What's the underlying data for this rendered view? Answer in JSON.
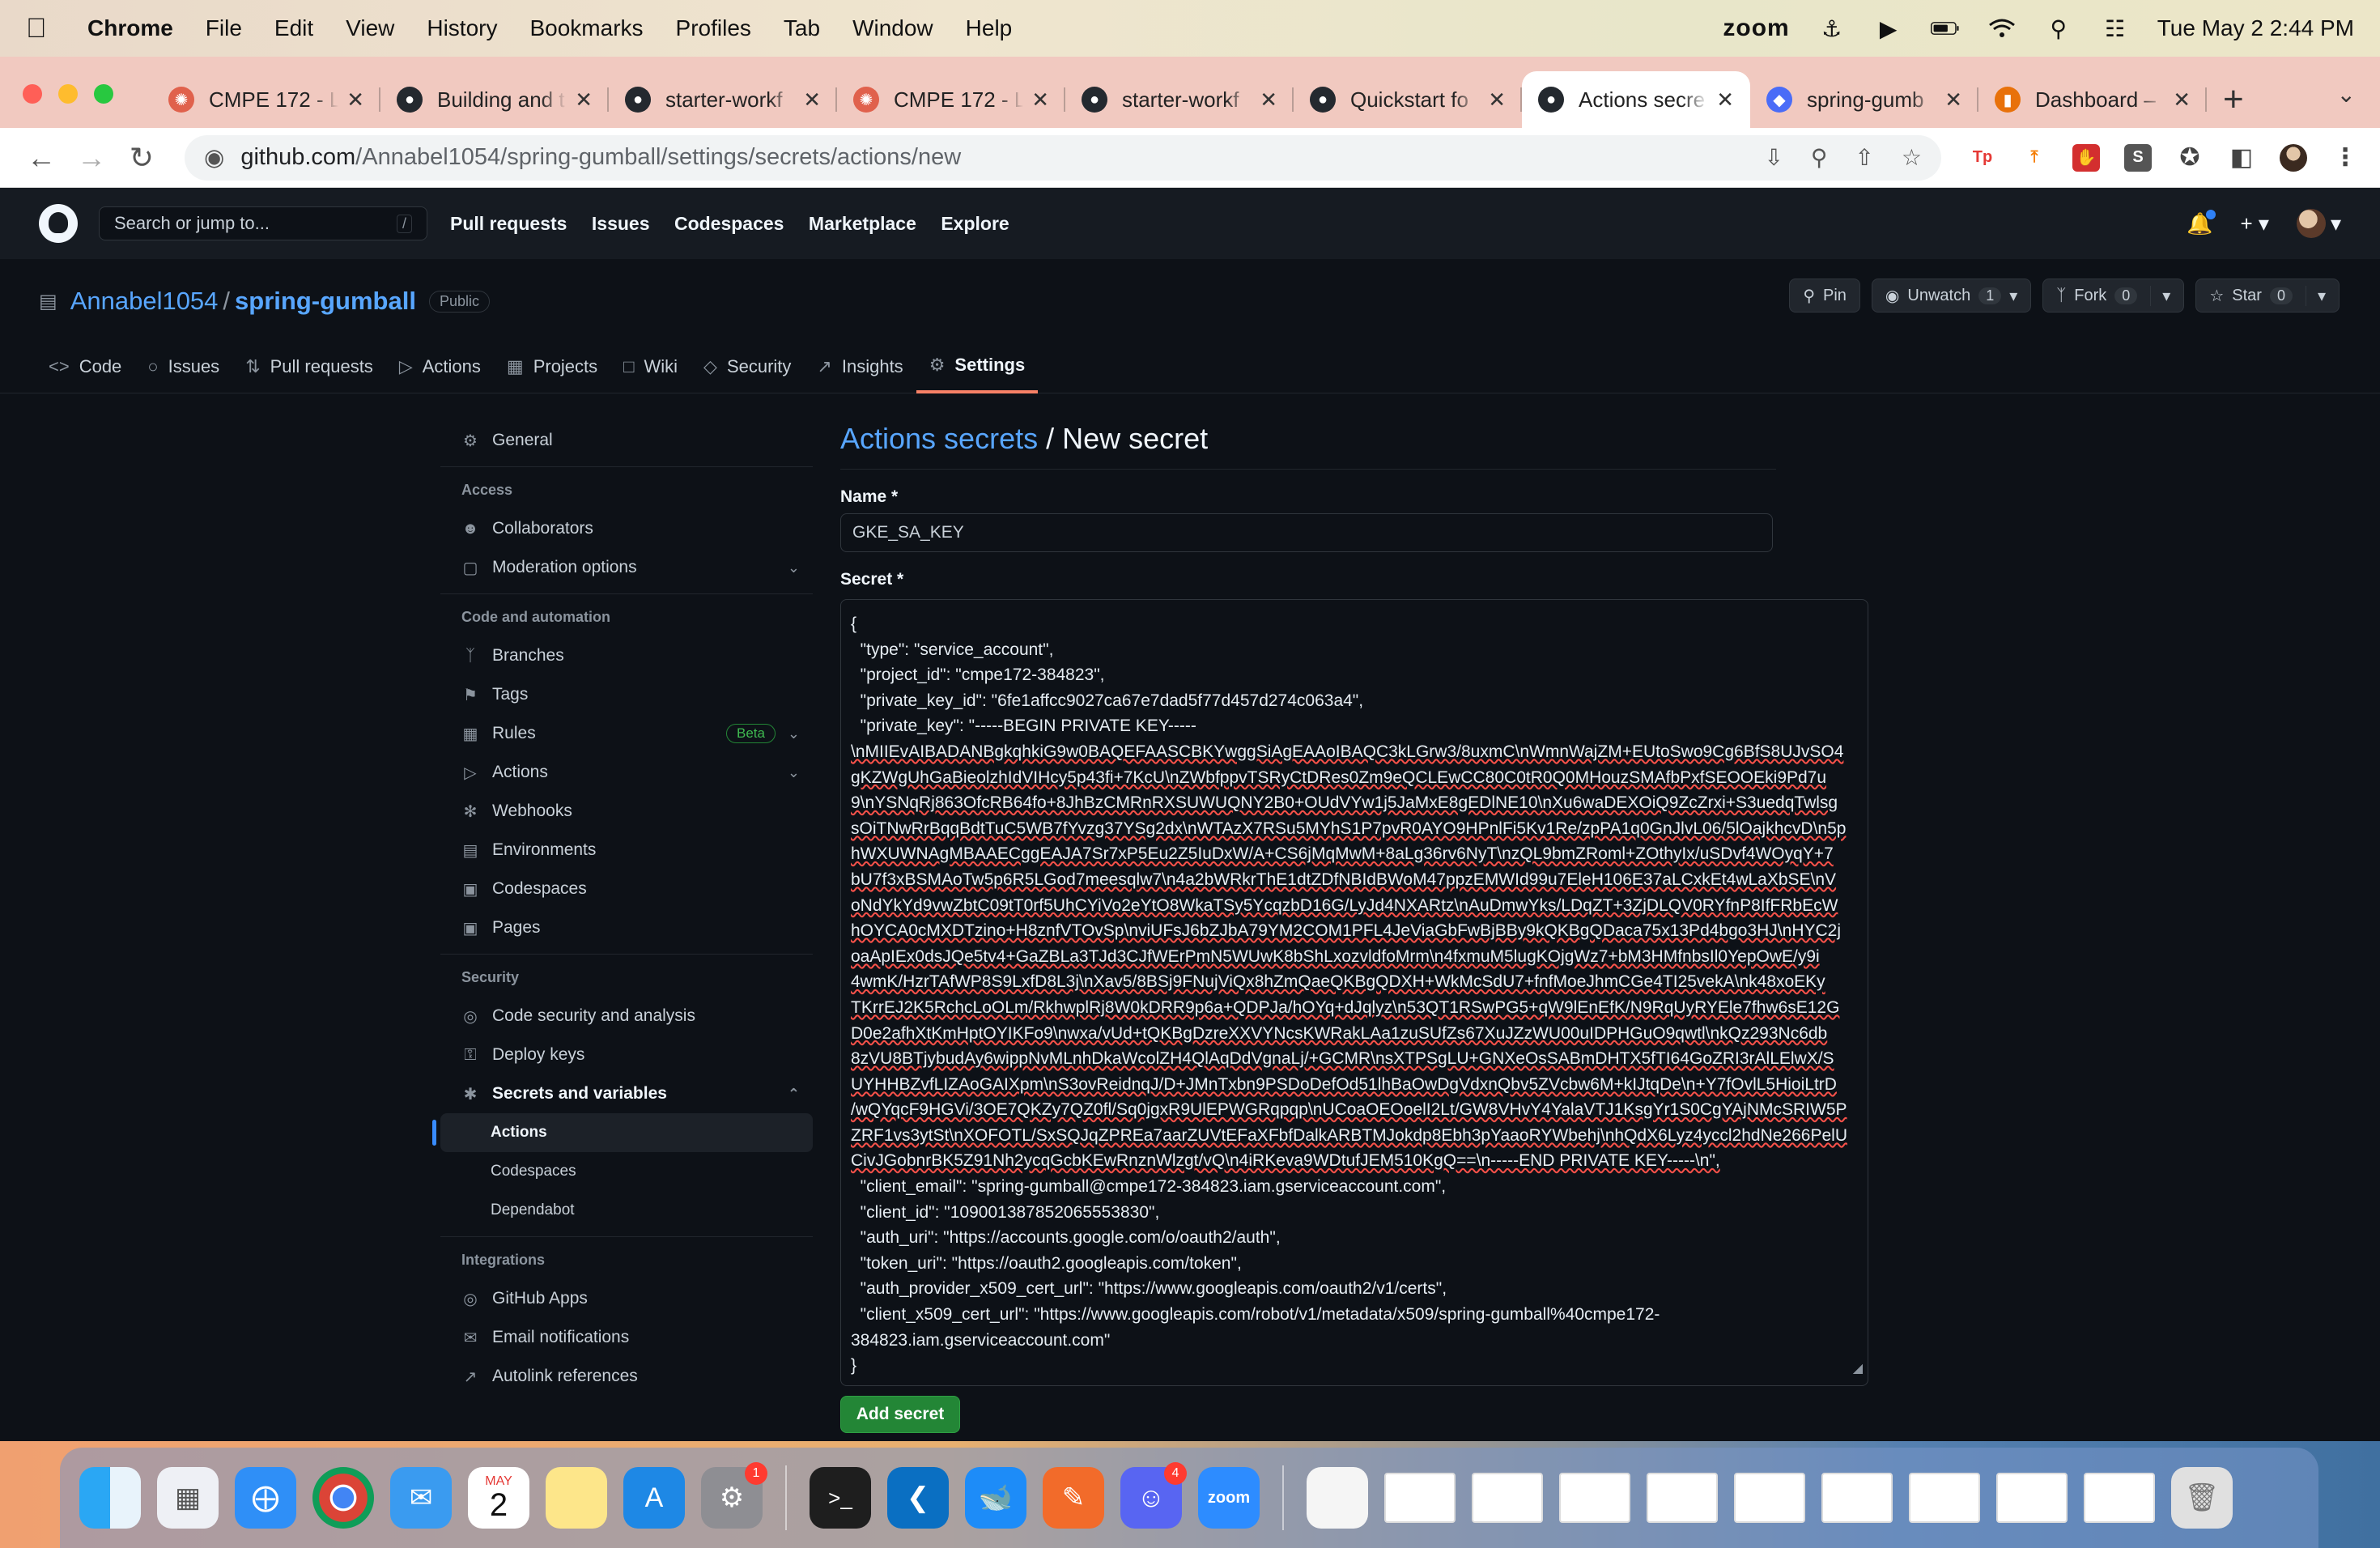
{
  "menubar": {
    "app": "Chrome",
    "items": [
      "File",
      "Edit",
      "View",
      "History",
      "Bookmarks",
      "Profiles",
      "Tab",
      "Window",
      "Help"
    ],
    "zoom": "zoom",
    "datetime": "Tue May 2  2:44 PM"
  },
  "tabs": [
    {
      "title": "CMPE 172 - L",
      "icon": "cmpe-icon",
      "color": "#e0614c"
    },
    {
      "title": "Building and t",
      "icon": "github-icon",
      "color": "#24292f"
    },
    {
      "title": "starter-workf",
      "icon": "github-icon",
      "color": "#24292f"
    },
    {
      "title": "CMPE 172 - L",
      "icon": "cmpe-icon",
      "color": "#e0614c"
    },
    {
      "title": "starter-workf",
      "icon": "github-icon",
      "color": "#24292f"
    },
    {
      "title": "Quickstart fo",
      "icon": "github-icon",
      "color": "#24292f"
    },
    {
      "title": "Actions secre",
      "icon": "github-icon",
      "color": "#24292f",
      "active": true
    },
    {
      "title": "spring-gumb",
      "icon": "shield-icon",
      "color": "#4a6cf7"
    },
    {
      "title": "Dashboard –",
      "icon": "chart-icon",
      "color": "#e8710a"
    }
  ],
  "address": {
    "host": "github.com",
    "path": "/Annabel1054/spring-gumball/settings/secrets/actions/new"
  },
  "gh": {
    "search_placeholder": "Search or jump to...",
    "search_key": "/",
    "nav": [
      "Pull requests",
      "Issues",
      "Codespaces",
      "Marketplace",
      "Explore"
    ]
  },
  "repo": {
    "owner": "Annabel1054",
    "separator": "/",
    "name": "spring-gumball",
    "visibility": "Public",
    "pin": "Pin",
    "unwatch": "Unwatch",
    "watch_count": "1",
    "fork": "Fork",
    "fork_count": "0",
    "star": "Star",
    "star_count": "0",
    "tabs": [
      {
        "label": "Code",
        "icon": "<>"
      },
      {
        "label": "Issues",
        "icon": "○"
      },
      {
        "label": "Pull requests",
        "icon": "⇅"
      },
      {
        "label": "Actions",
        "icon": "▷"
      },
      {
        "label": "Projects",
        "icon": "▦"
      },
      {
        "label": "Wiki",
        "icon": "□"
      },
      {
        "label": "Security",
        "icon": "◇"
      },
      {
        "label": "Insights",
        "icon": "↗"
      },
      {
        "label": "Settings",
        "icon": "⚙"
      }
    ]
  },
  "sidebar": {
    "general": "General",
    "access_heading": "Access",
    "collaborators": "Collaborators",
    "moderation": "Moderation options",
    "code_heading": "Code and automation",
    "branches": "Branches",
    "tags": "Tags",
    "rules": "Rules",
    "beta": "Beta",
    "actions": "Actions",
    "webhooks": "Webhooks",
    "environments": "Environments",
    "codespaces": "Codespaces",
    "pages": "Pages",
    "security_heading": "Security",
    "code_security": "Code security and analysis",
    "deploy_keys": "Deploy keys",
    "secrets": "Secrets and variables",
    "sub_actions": "Actions",
    "sub_codespaces": "Codespaces",
    "sub_dependabot": "Dependabot",
    "integrations_heading": "Integrations",
    "github_apps": "GitHub Apps",
    "email_notifications": "Email notifications",
    "autolink": "Autolink references"
  },
  "main": {
    "crumb": "Actions secrets",
    "sep": "/",
    "title": "New secret",
    "name_label": "Name *",
    "name_value": "GKE_SA_KEY",
    "secret_label": "Secret *",
    "secret_lines": [
      "{",
      "  \"type\": \"service_account\",",
      "  \"project_id\": \"cmpe172-384823\",",
      "  \"private_key_id\": \"6fe1affcc9027ca67e7dad5f77d457d274c063a4\",",
      "  \"private_key\": \"-----BEGIN PRIVATE KEY-----",
      "\\nMIIEvAIBADANBgkqhkiG9w0BAQEFAASCBKYwggSiAgEAAoIBAQC3kLGrw3/8uxmC\\nWmnWajZM+EUtoSwo9Cg6BfS8UJvSO4",
      "gKZWgUhGaBieolzhIdVIHcy5p43fi+7KcU\\nZWbfppvTSRyCtDRes0Zm9eQCLEwCC80C0tR0Q0MHouzSMAfbPxfSEOOEki9Pd7u",
      "9\\nYSNqRj863OfcRB64fo+8JhBzCMRnRXSUWUQNY2B0+OUdVYw1j5JaMxE8gEDlNE10\\nXu6waDEXOiQ9ZcZrxi+S3uedqTwlsg",
      "sOiTNwRrBqqBdtTuC5WB7fYvzg37YSg2dx\\nWTAzX7RSu5MYhS1P7pvR0AYO9HPnlFi5Kv1Re/zpPA1q0GnJlvL06/5lOajkhcvD\\n5p",
      "hWXUWNAgMBAAECggEAJA7Sr7xP5Eu2Z5IuDxW/A+CS6jMqMwM+8aLg36rv6NyT\\nzQL9bmZRoml+ZOthyIx/uSDvf4WOyqY+7",
      "bU7f3xBSMAoTw5p6R5LGod7meesqlw7\\n4a2bWRkrThE1dtZDfNBIdBWoM47ppzEMWId99u7EleH106E37aLCxkEt4wLaXbSE\\nV",
      "oNdYkYd9vwZbtC09tT0rf5UhCYiVo2eYtO8WkaTSy5YcqzbD16G/LyJd4NXARtz\\nAuDmwYks/LDqZT+3ZjDLQV0RYfnP8IfFRbEcW",
      "hOYCA0cMXDTzino+H8znfVTOvSp\\nviUFsJ6bZJbA79YM2COM1PFL4JeViaGbFwBjBBy9kQKBgQDaca75x13Pd4bgo3HJ\\nHYC2j",
      "oaApIEx0dsJQe5tv4+GaZBLa3TJd3CJfWErPmN5WUwK8bShLxozvldfoMrm\\n4fxmuM5lugKOjgWz7+bM3HMfnbsIl0YepOwE/y9i",
      "4wmK/HzrTAfWP8S9LxfD8L3j\\nXav5/8BSj9FNujViQx8hZmQaeQKBgQDXH+WkMcSdU7+fnfMoeJhmCGe4TI25vekA\\nk48xoEKy",
      "TKrrEJ2K5RchcLoOLm/RkhwplRj8W0kDRR9p6a+QDPJa/hOYq+dJqlyz\\n53QT1RSwPG5+qW9lEnEfK/N9RqUyRYEle7fhw6sE12G",
      "D0e2afhXtKmHptOYIKFo9\\nwxa/vUd+tQKBgDzreXXVYNcsKWRakLAa1zuSUfZs67XuJZzWU00uIDPHGuO9qwtl\\nkQz293Nc6db",
      "8zVU8BTjybudAy6wippNvMLnhDkaWcolZH4QlAqDdVgnaLj/+GCMR\\nsXTPSgLU+GNXeOsSABmDHTX5fTI64GoZRI3rAlLElwX/S",
      "UYHHBZvfLIZAoGAIXpm\\nS3ovReidnqJ/D+JMnTxbn9PSDoDefOd51lhBaOwDgVdxnQbv5ZVcbw6M+kIJtqDe\\n+Y7fOvlL5HioiLtrD",
      "/wQYqcF9HGVi/3OE7QKZy7QZ0fl/Sq0jgxR9UlEPWGRqpqp\\nUCoaOEOoelI2Lt/GW8VHvY4YalaVTJ1KsgYr1S0CgYAjNMcSRIW5P",
      "ZRF1vs3ytSt\\nXOFOTL/SxSQJqZPREa7aarZUVtEFaXFbfDalkARBTMJokdp8Ebh3pYaaoRYWbehj\\nhQdX6Lyz4yccl2hdNe266PelU",
      "CivJGobnrBK5Z91Nh2ycqGcbKEwRnznWlzgt/vQ\\n4iRKeva9WDtufJEM510KgQ==\\n-----END PRIVATE KEY-----\\n\",",
      "  \"client_email\": \"spring-gumball@cmpe172-384823.iam.gserviceaccount.com\",",
      "  \"client_id\": \"109001387852065553830\",",
      "  \"auth_uri\": \"https://accounts.google.com/o/oauth2/auth\",",
      "  \"token_uri\": \"https://oauth2.googleapis.com/token\",",
      "  \"auth_provider_x509_cert_url\": \"https://www.googleapis.com/oauth2/v1/certs\",",
      "  \"client_x509_cert_url\": \"https://www.googleapis.com/robot/v1/metadata/x509/spring-gumball%40cmpe172-",
      "384823.iam.gserviceaccount.com\"",
      "}"
    ],
    "add_button": "Add secret"
  },
  "dock": {
    "calendar_month": "MAY",
    "calendar_day": "2",
    "settings_badge": "1",
    "discord_badge": "4",
    "zoom_label": "zoom"
  }
}
